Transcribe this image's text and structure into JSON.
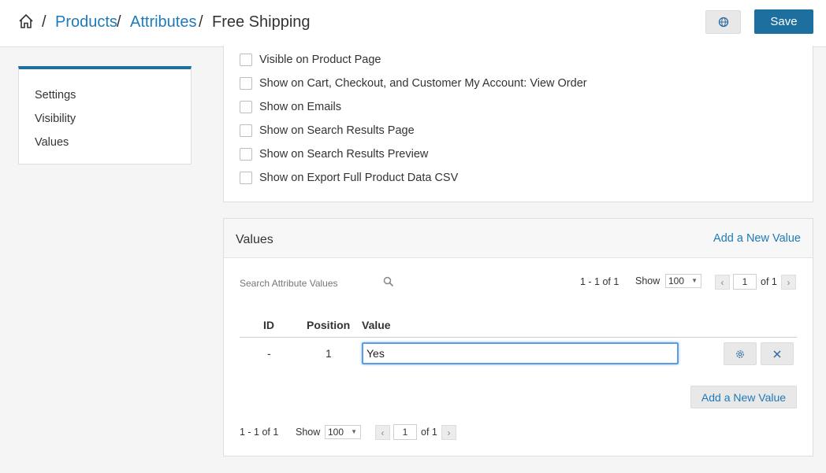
{
  "breadcrumb": {
    "items": [
      "Products",
      "Attributes"
    ],
    "separator": "/",
    "current": "Free Shipping"
  },
  "header": {
    "save_label": "Save",
    "globe_icon": "globe-icon",
    "home_icon": "home-icon"
  },
  "sidebar": {
    "items": [
      {
        "label": "Settings"
      },
      {
        "label": "Visibility"
      },
      {
        "label": "Values"
      }
    ]
  },
  "visibility": {
    "options": [
      {
        "label": "Visible on Product Page",
        "checked": false
      },
      {
        "label": "Show on Cart, Checkout, and Customer My Account: View Order",
        "checked": false
      },
      {
        "label": "Show on Emails",
        "checked": false
      },
      {
        "label": "Show on Search Results Page",
        "checked": false
      },
      {
        "label": "Show on Search Results Preview",
        "checked": false
      },
      {
        "label": "Show on Export Full Product Data CSV",
        "checked": false
      }
    ]
  },
  "values": {
    "title": "Values",
    "add_link": "Add a New Value",
    "search_placeholder": "Search Attribute Values",
    "pagination_top": {
      "range": "1 - 1 of 1",
      "show_label": "Show",
      "show_value": "100",
      "page": "1",
      "of_label": "of 1"
    },
    "pagination_bottom": {
      "range": "1 - 1 of 1",
      "show_label": "Show",
      "show_value": "100",
      "page": "1",
      "of_label": "of 1"
    },
    "columns": [
      "ID",
      "Position",
      "Value"
    ],
    "rows": [
      {
        "id": "-",
        "position": "1",
        "value": "Yes"
      }
    ],
    "add_button": "Add a New Value"
  },
  "colors": {
    "accent": "#1d6fa0",
    "link": "#1e7ab8"
  }
}
